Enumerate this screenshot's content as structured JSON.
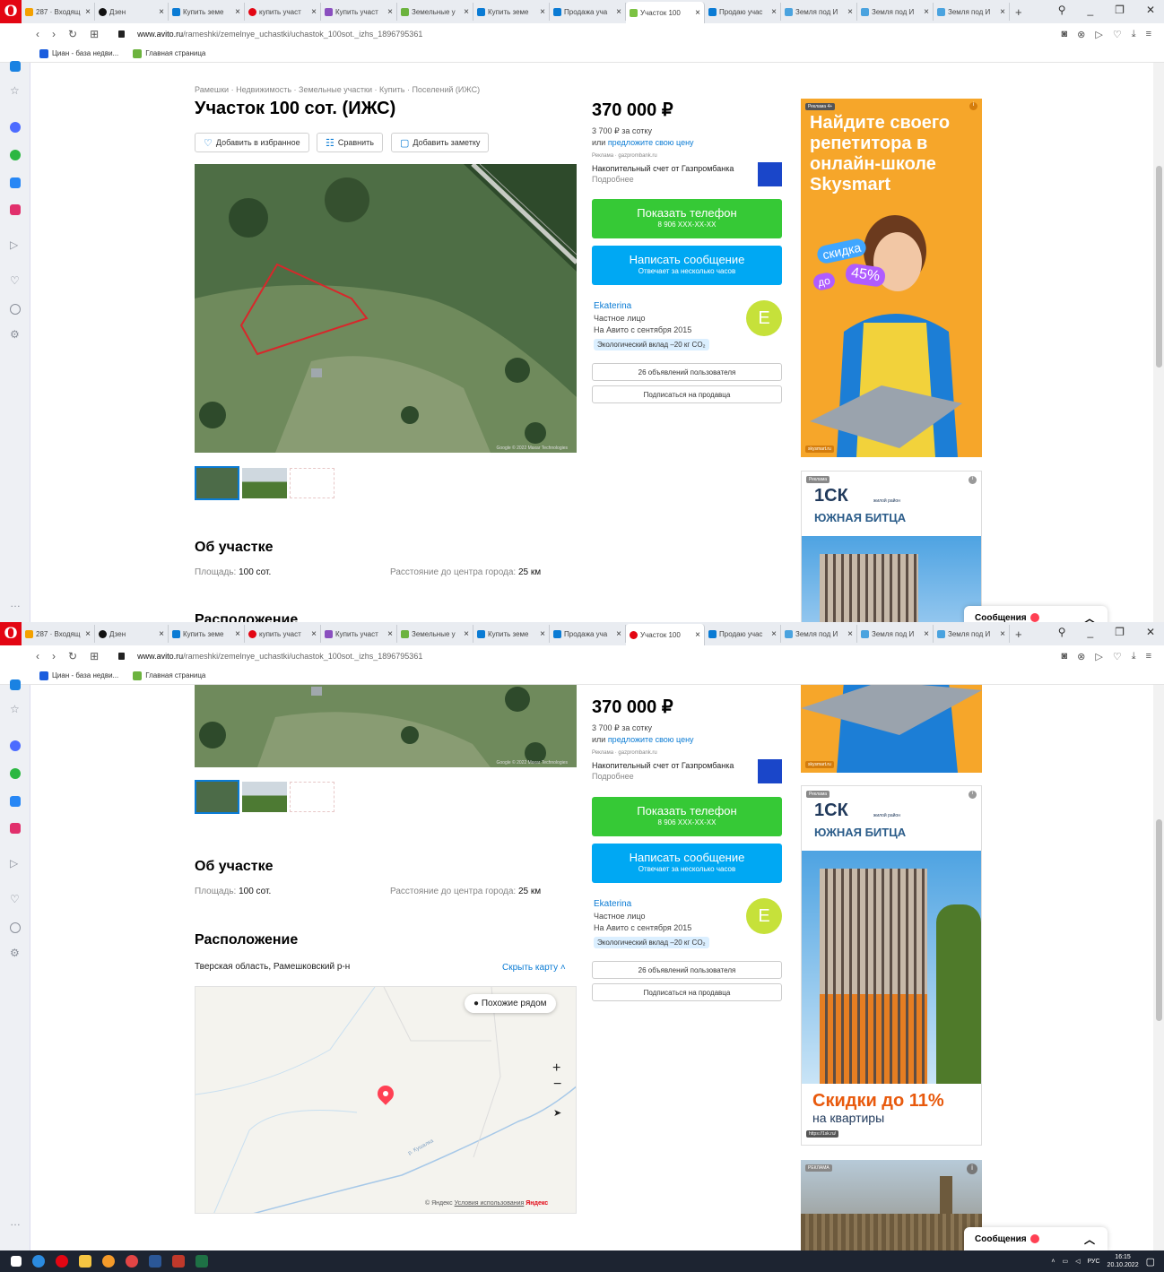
{
  "browser": {
    "tabs": [
      {
        "label": "287 · Входящ",
        "color": "#f4a100"
      },
      {
        "label": "Дзен",
        "color": "#111111"
      },
      {
        "label": "Купить земе",
        "color": "#0a7bd4"
      },
      {
        "label": "купить участ",
        "color": "#e30613"
      },
      {
        "label": "Купить участ",
        "color": "#8a4fbf"
      },
      {
        "label": "Земельные у",
        "color": "#6cb33e"
      },
      {
        "label": "Купить земе",
        "color": "#0a7bd4"
      },
      {
        "label": "Продажа уча",
        "color": "#0a7bd4"
      },
      {
        "label": "Участок 100",
        "color": "#7cc243"
      },
      {
        "label": "Продаю учас",
        "color": "#0a7bd4"
      },
      {
        "label": "Земля под И",
        "color": "#4aa3df"
      },
      {
        "label": "Земля под И",
        "color": "#4aa3df"
      },
      {
        "label": "Земля под И",
        "color": "#4aa3df"
      }
    ],
    "url_host": "www.avito.ru",
    "url_path": "/rameshki/zemelnye_uchastki/uchastok_100sot._izhs_1896795361",
    "bookmarks": [
      "Циан - база недви...",
      "Главная страница"
    ]
  },
  "listing": {
    "breadcrumbs": "Рамешки · Недвижимость · Земельные участки · Купить · Поселений (ИЖС)",
    "title": "Участок 100 сот. (ИЖС)",
    "fav_label": "Добавить в избранное",
    "compare_label": "Сравнить",
    "note_label": "Добавить заметку",
    "photo_copyright": "Google © 2022 Maxar Technologies",
    "price": "370 000 ₽",
    "price_per": "3 700 ₽ за сотку",
    "offer_prefix": "или ",
    "offer_link": "предложите свою цену",
    "ad_label": "Реклама · gazprombank.ru",
    "ad_title": "Накопительный счет от Газпромбанка",
    "ad_more": "Подробнее",
    "phone_label": "Показать телефон",
    "phone_number": "8 906 XXX-XX-XX",
    "message_label": "Написать сообщение",
    "message_sub": "Отвечает за несколько часов",
    "seller_name": "Ekaterina",
    "seller_type": "Частное лицо",
    "seller_since": "На Авито с сентября 2015",
    "seller_initial": "E",
    "eco": "Экологический вклад –20 кг CO₂",
    "user_ads": "26 объявлений пользователя",
    "subscribe": "Подписаться на продавца",
    "about_title": "Об участке",
    "area_label": "Площадь: ",
    "area_value": "100 сот.",
    "distance_label": "Расстояние до центра города: ",
    "distance_value": "25 км",
    "location_title": "Расположение",
    "address": "Тверская область, Рамешковский р-н",
    "hide_map": "Скрыть карту",
    "similar_nearby": "Похожие рядом",
    "river": "р. Кушалка",
    "map_credit": "© Яндекс",
    "map_terms": "Условия использования",
    "map_brand": "Яндекс"
  },
  "ads": {
    "sky_badge": "Реклама 4+",
    "sky_title": "Найдите своего репетитора в онлайн-школе Skysmart",
    "sky_discount": "скидка",
    "sky_do": "до",
    "sky_pct": "45%",
    "sky_domain": "skysmart.ru",
    "ck_badge": "Реклама",
    "ck_logo": "1СК",
    "ck_sub": "жилой район",
    "ck_name": "ЮЖНАЯ БИТЦА",
    "ck_sale": "Скидки до 11%",
    "ck_sale2": "на квартиры",
    "ck_domain": "https://1sk.ru/",
    "third_badge": "РЕКЛАМА"
  },
  "messages": {
    "label": "Сообщения"
  },
  "taskbar": {
    "lang": "РУС",
    "time": "16:15",
    "date": "20.10.2022"
  }
}
